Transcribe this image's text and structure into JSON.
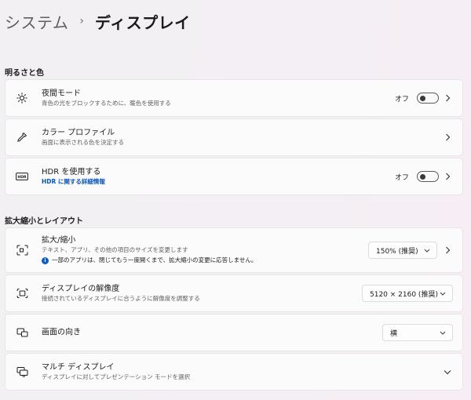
{
  "breadcrumb": {
    "parent": "システム",
    "separator": "›",
    "current": "ディスプレイ"
  },
  "sections": {
    "brightness": "明るさと色",
    "scale_layout": "拡大縮小とレイアウト"
  },
  "night_light": {
    "title": "夜間モード",
    "subtitle": "青色の光をブロックするために、暖色を使用する",
    "toggle_label": "オフ",
    "toggle_on": false
  },
  "color_profile": {
    "title": "カラー プロファイル",
    "subtitle": "画面に表示される色を決定する"
  },
  "hdr": {
    "title": "HDR を使用する",
    "link": "HDR に関する詳細情報",
    "toggle_label": "オフ",
    "toggle_on": false
  },
  "scale": {
    "title": "拡大/縮小",
    "subtitle": "テキスト、アプリ、その他の項目のサイズを変更します",
    "note": "一部のアプリは、閉じてもう一度開くまで、拡大縮小の変更に応答しません。",
    "value": "150% (推奨)"
  },
  "resolution": {
    "title": "ディスプレイの解像度",
    "subtitle": "接続されているディスプレイに合うように解像度を調整する",
    "value": "5120 × 2160 (推奨)"
  },
  "orientation": {
    "title": "画面の向き",
    "value": "横"
  },
  "multi_display": {
    "title": "マルチ ディスプレイ",
    "subtitle": "ディスプレイに対してプレゼンテーション モードを選択"
  }
}
